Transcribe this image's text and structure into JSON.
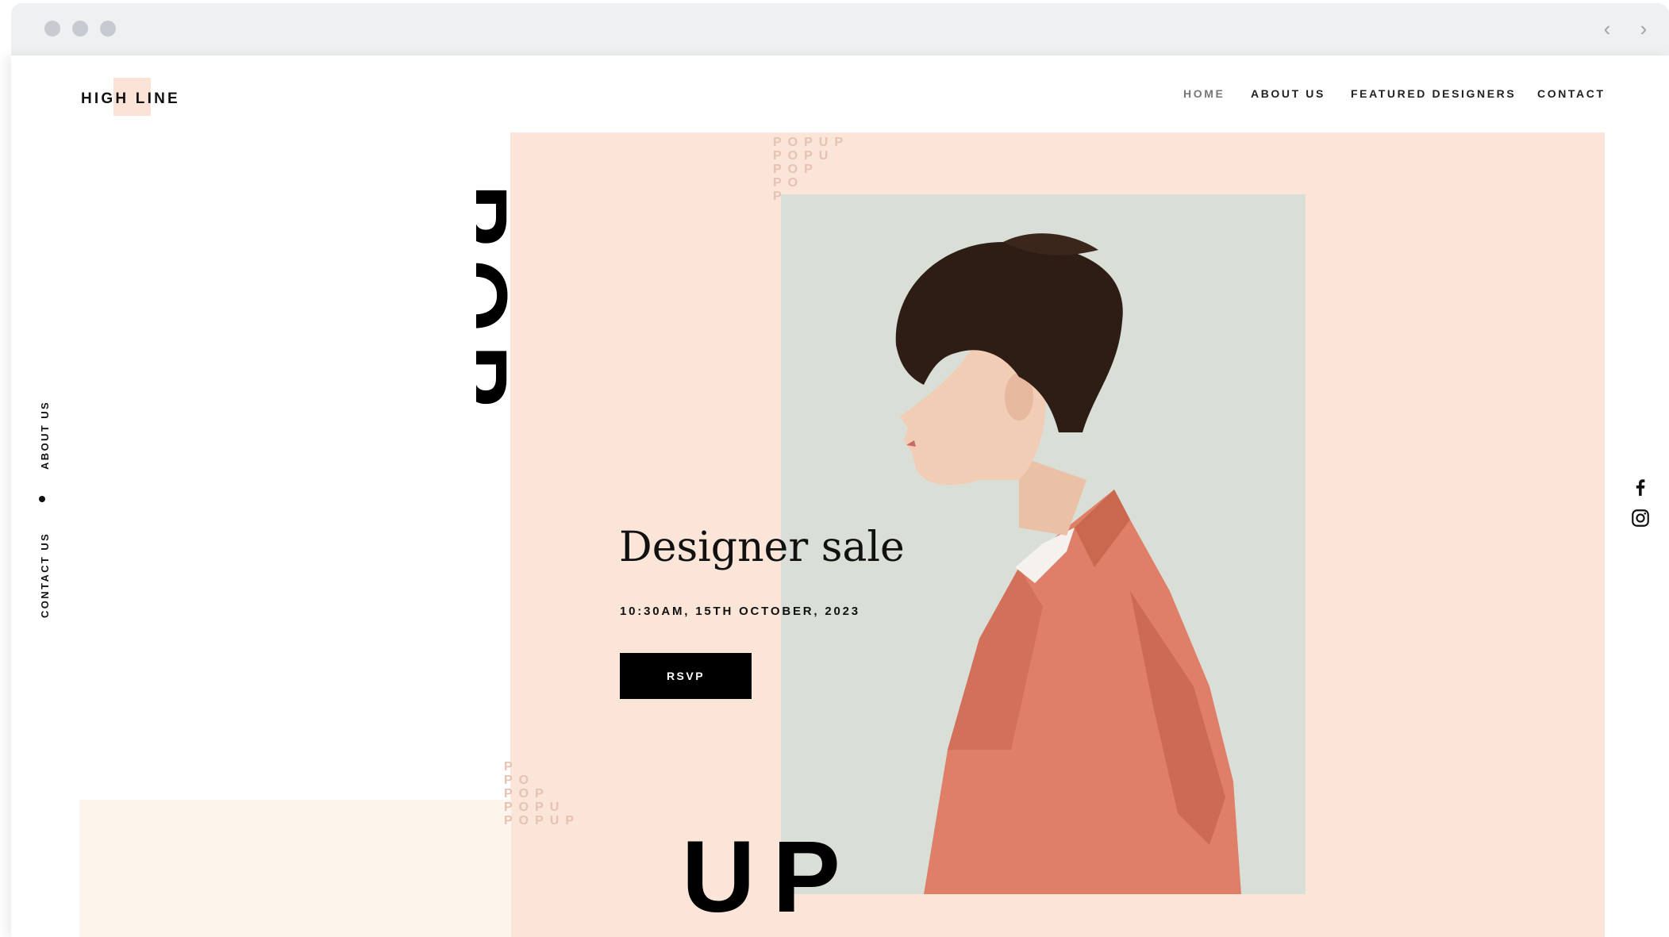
{
  "brand": {
    "logo": "HIGH LINE",
    "accent_color": "#fbe4d7"
  },
  "nav": {
    "items": [
      {
        "label": "HOME",
        "active": true
      },
      {
        "label": "ABOUT US",
        "active": false
      },
      {
        "label": "FEATURED DESIGNERS",
        "active": false
      },
      {
        "label": "CONTACT",
        "active": false
      }
    ]
  },
  "side_nav": {
    "about_label": "ABOUT US",
    "contact_label": "CONTACT US"
  },
  "hero": {
    "big_word_top": "POP",
    "big_word_bottom": "UP",
    "small_pattern_top": [
      "POPUP",
      "POPU",
      "POP",
      "PO",
      "P"
    ],
    "small_pattern_bottom": [
      "P",
      "PO",
      "POP",
      "POPU",
      "POPUP"
    ],
    "headline": "Designer sale",
    "date": "10:30AM, 15TH OCTOBER, 2023",
    "button_label": "RSVP"
  },
  "social": {
    "icons": [
      "facebook-icon",
      "instagram-icon"
    ]
  },
  "colors": {
    "peach": "#fae5d8",
    "sage": "#d9dfd7",
    "cream": "#fdf4ec",
    "coat": "#e07f68"
  }
}
